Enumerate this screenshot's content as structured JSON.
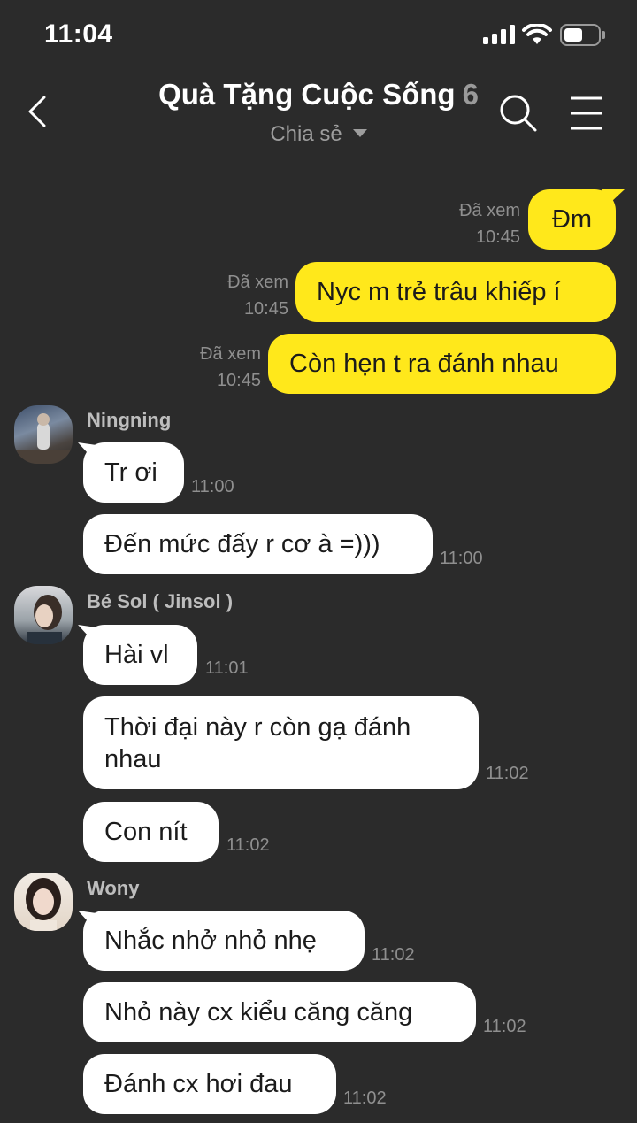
{
  "status_bar": {
    "time": "11:04"
  },
  "header": {
    "title": "Quà Tặng Cuộc Sống",
    "member_count": "6",
    "subtitle": "Chia sẻ"
  },
  "outgoing": [
    {
      "text": "Đm",
      "seen": "Đã xem",
      "time": "10:45"
    },
    {
      "text": "Nyc m trẻ trâu khiếp í",
      "seen": "Đã xem",
      "time": "10:45"
    },
    {
      "text": "Còn hẹn t ra đánh nhau",
      "seen": "Đã xem",
      "time": "10:45"
    }
  ],
  "groups": [
    {
      "sender": "Ningning",
      "avatar_icon": "avatar-photo-icon",
      "messages": [
        {
          "text": "Tr ơi",
          "time": "11:00"
        },
        {
          "text": "Đến mức đấy r cơ à =)))",
          "time": "11:00"
        }
      ]
    },
    {
      "sender": "Bé Sol ( Jinsol )",
      "avatar_icon": "avatar-photo-icon",
      "messages": [
        {
          "text": "Hài vl",
          "time": "11:01"
        },
        {
          "text": "Thời đại này r còn gạ đánh nhau",
          "time": "11:02"
        },
        {
          "text": "Con nít",
          "time": "11:02"
        }
      ]
    },
    {
      "sender": "Wony",
      "avatar_icon": "avatar-photo-icon",
      "messages": [
        {
          "text": "Nhắc nhở nhỏ nhẹ",
          "time": "11:02"
        },
        {
          "text": "Nhỏ này cx kiểu căng căng",
          "time": "11:02"
        },
        {
          "text": "Đánh cx hơi đau",
          "time": "11:02"
        }
      ]
    }
  ]
}
